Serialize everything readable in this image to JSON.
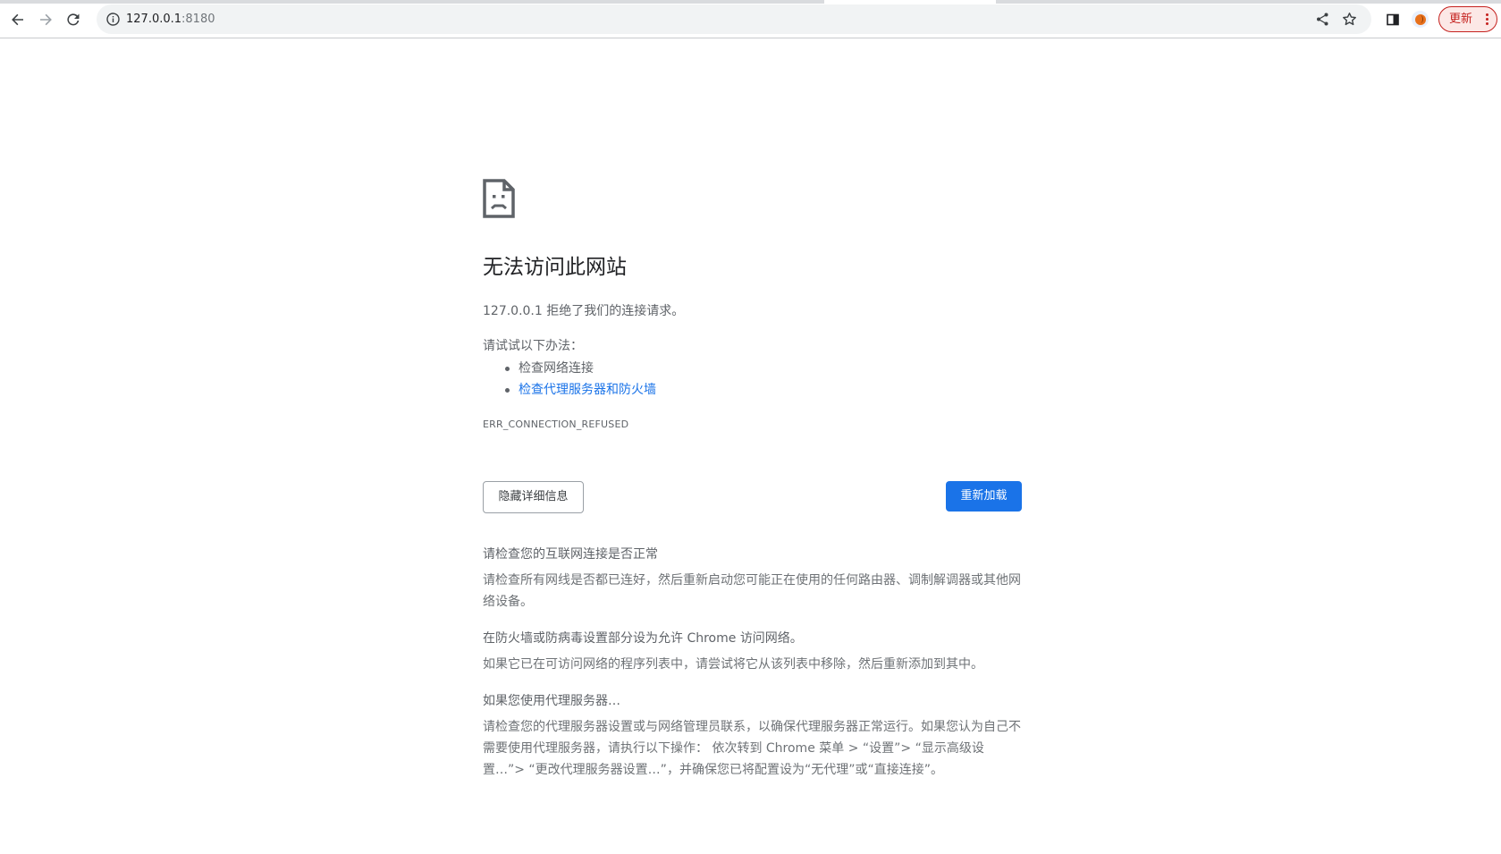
{
  "browser": {
    "url_host": "127.0.0.1",
    "url_port": ":8180",
    "update_label": "更新",
    "icons": {
      "back": "back-arrow-icon",
      "forward": "forward-arrow-icon",
      "reload": "reload-icon",
      "site_info": "info-icon",
      "share": "share-icon",
      "bookmark": "star-icon",
      "side_panel": "side-panel-icon",
      "profile": "profile-avatar-icon",
      "menu": "kebab-menu-icon"
    }
  },
  "error": {
    "title": "无法访问此网站",
    "summary": "127.0.0.1 拒绝了我们的连接请求。",
    "suggestions_heading": "请试试以下办法：",
    "suggestions": [
      {
        "label": "检查网络连接",
        "link": false
      },
      {
        "label": "检查代理服务器和防火墙",
        "link": true
      }
    ],
    "code": "ERR_CONNECTION_REFUSED",
    "details_button": "隐藏详细信息",
    "reload_button": "重新加载",
    "details": [
      {
        "heading": "请检查您的互联网连接是否正常",
        "body": "请检查所有网线是否都已连好，然后重新启动您可能正在使用的任何路由器、调制解调器或其他网络设备。"
      },
      {
        "heading": "在防火墙或防病毒设置部分设为允许 Chrome 访问网络。",
        "body": "如果它已在可访问网络的程序列表中，请尝试将它从该列表中移除，然后重新添加到其中。"
      },
      {
        "heading": "如果您使用代理服务器…",
        "body": "请检查您的代理服务器设置或与网络管理员联系，以确保代理服务器正常运行。如果您认为自己不需要使用代理服务器，请执行以下操作： 依次转到 Chrome 菜单 > “设置”> “显示高级设置…”> “更改代理服务器设置…”，并确保您已将配置设为“无代理”或“直接连接”。"
      }
    ]
  },
  "colors": {
    "accent": "#1a73e8",
    "update": "#c5221f"
  }
}
